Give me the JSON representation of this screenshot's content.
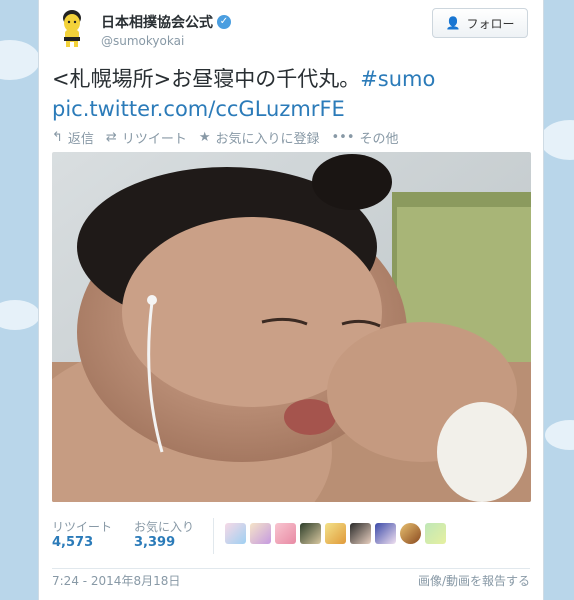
{
  "profile": {
    "display_name": "日本相撲協会公式",
    "handle": "@sumokyokai",
    "follow_label": "フォロー",
    "follow_icon": "person-plus-icon"
  },
  "tweet": {
    "text": "<札幌場所>お昼寝中の千代丸。",
    "hashtag": "#sumo",
    "link": "pic.twitter.com/ccGLuzmrFE"
  },
  "actions": {
    "reply": "返信",
    "retweet": "リツイート",
    "favorite": "お気に入りに登録",
    "more": "その他"
  },
  "stats": {
    "retweets_label": "リツイート",
    "retweets_count": "4,573",
    "favorites_label": "お気に入り",
    "favorites_count": "3,399"
  },
  "footer": {
    "timestamp": "7:24 - 2014年8月18日",
    "report": "画像/動画を報告する"
  },
  "colors": {
    "link": "#2b7bb9",
    "muted": "#8899a6",
    "text": "#292f33",
    "background": "#b9d6ea"
  }
}
